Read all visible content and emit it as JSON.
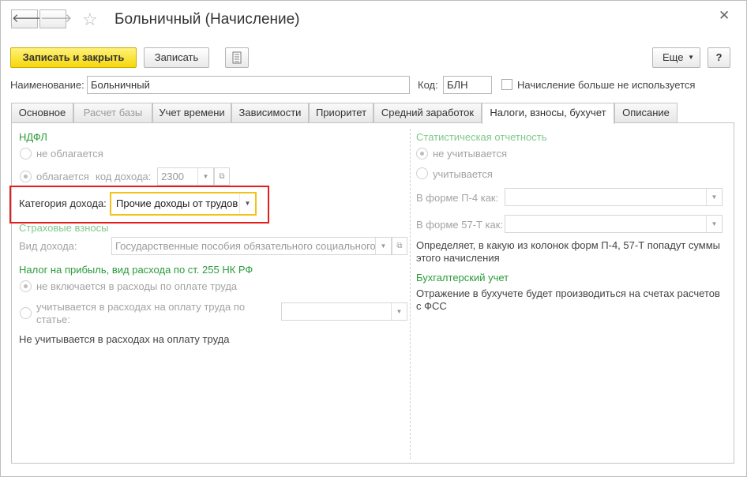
{
  "window": {
    "title": "Больничный (Начисление)"
  },
  "toolbar": {
    "back_icon": "arrow-left-icon",
    "forward_icon": "arrow-right-icon",
    "save_close_label": "Записать и закрыть",
    "save_label": "Записать",
    "more_label": "Еще",
    "help_label": "?"
  },
  "header": {
    "name_label": "Наименование:",
    "name_value": "Больничный",
    "code_label": "Код:",
    "code_value": "БЛН",
    "unused_label": "Начисление больше не используется"
  },
  "tabs": [
    {
      "label": "Основное"
    },
    {
      "label": "Расчет базы"
    },
    {
      "label": "Учет времени"
    },
    {
      "label": "Зависимости"
    },
    {
      "label": "Приоритет"
    },
    {
      "label": "Средний заработок"
    },
    {
      "label": "Налоги, взносы, бухучет"
    },
    {
      "label": "Описание"
    }
  ],
  "ndfl": {
    "title": "НДФЛ",
    "not_taxed": "не облагается",
    "taxed": "облагается",
    "income_code_label": "код дохода:",
    "income_code_value": "2300",
    "income_category_label": "Категория дохода:",
    "income_category_value": "Прочие доходы от трудов"
  },
  "insurance": {
    "title": "Страховые взносы",
    "income_type_label": "Вид дохода:",
    "income_type_value": "Государственные пособия обязательного социального"
  },
  "profit_tax": {
    "title": "Налог на прибыль, вид расхода по ст. 255 НК РФ",
    "not_included": "не включается в расходы по оплате труда",
    "included_line1": "учитывается в расходах на оплату труда по",
    "included_line2": "статье:",
    "note": "Не учитывается в расходах на оплату труда"
  },
  "stats": {
    "title": "Статистическая отчетность",
    "not_counted": "не учитывается",
    "counted": "учитывается",
    "p4_label": "В форме П-4 как:",
    "t57_label": "В форме 57-Т как:",
    "description_line1": "Определяет, в какую из колонок форм П-4, 57-Т попадут суммы",
    "description_line2": "этого начисления"
  },
  "accounting": {
    "title": "Бухгалтерский учет",
    "text_line1": "Отражение в бухучете будет производиться на счетах расчетов",
    "text_line2": "с ФСС"
  },
  "colors": {
    "highlight": "#e31c1c",
    "section_green": "#2a9b3a",
    "primary_button": "#f5d70b"
  }
}
